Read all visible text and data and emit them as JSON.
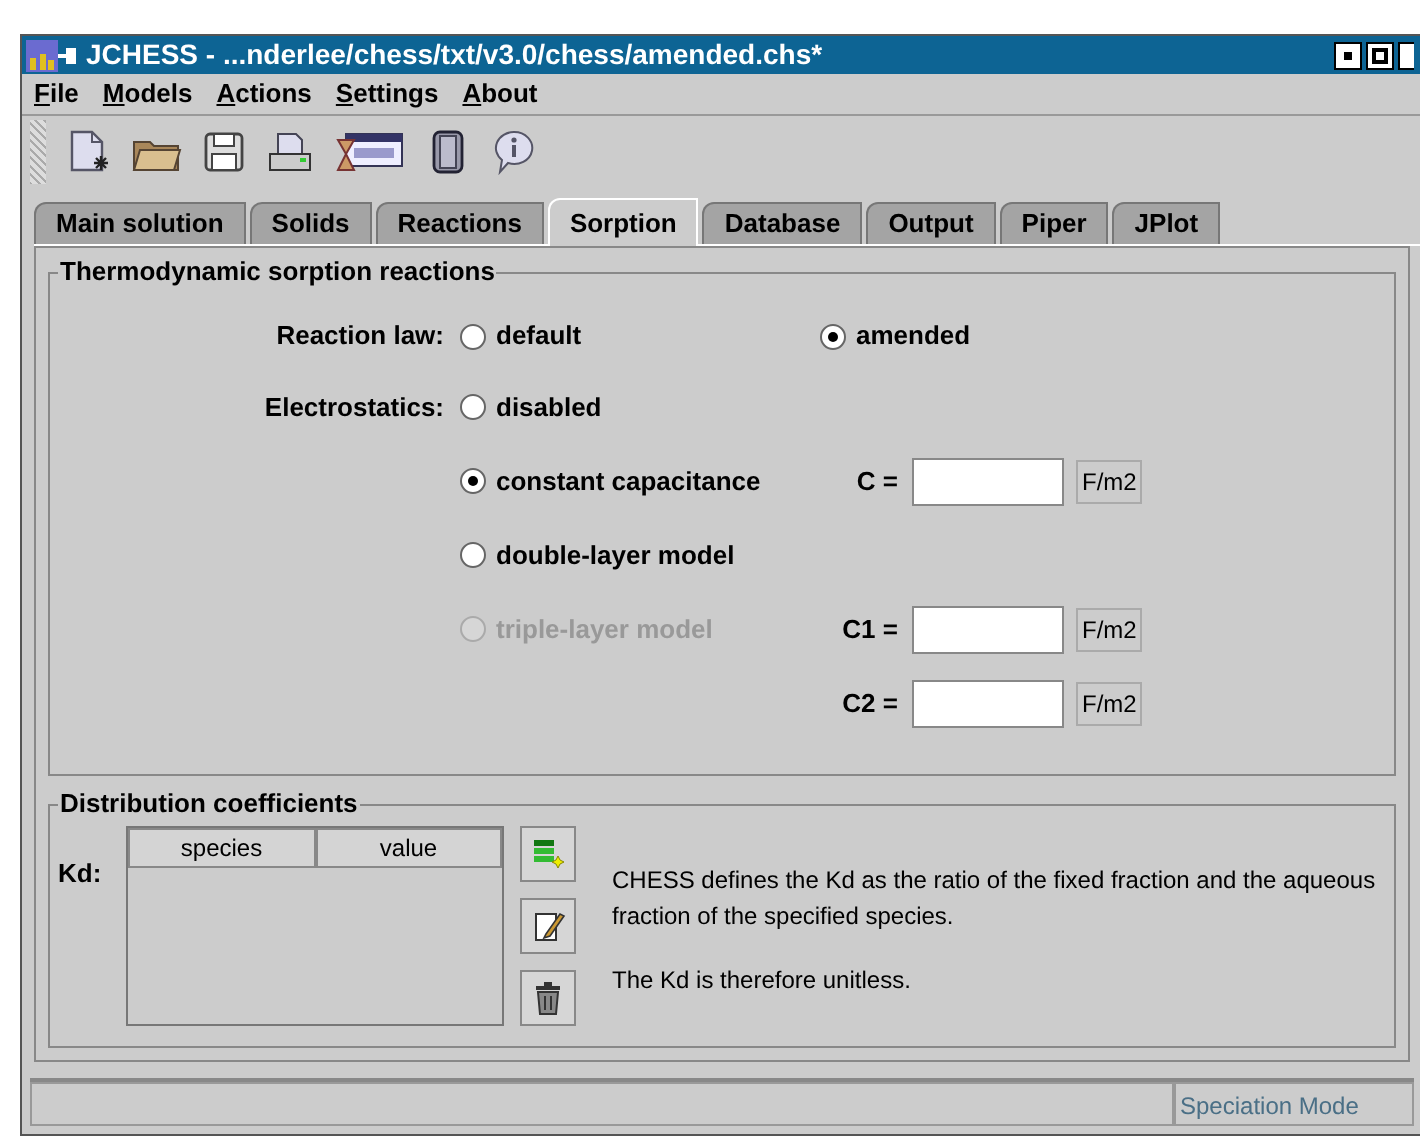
{
  "window": {
    "title": "JCHESS - ...nderlee/chess/txt/v3.0/chess/amended.chs*"
  },
  "menu": [
    {
      "label": "File"
    },
    {
      "label": "Models"
    },
    {
      "label": "Actions"
    },
    {
      "label": "Settings"
    },
    {
      "label": "About"
    }
  ],
  "tabs": [
    {
      "label": "Main solution",
      "selected": false
    },
    {
      "label": "Solids",
      "selected": false
    },
    {
      "label": "Reactions",
      "selected": false
    },
    {
      "label": "Sorption",
      "selected": true
    },
    {
      "label": "Database",
      "selected": false
    },
    {
      "label": "Output",
      "selected": false
    },
    {
      "label": "Piper",
      "selected": false
    },
    {
      "label": "JPlot",
      "selected": false
    }
  ],
  "sorption": {
    "title": "Thermodynamic sorption reactions",
    "reaction_law": {
      "label": "Reaction law:",
      "options": [
        {
          "label": "default",
          "selected": false
        },
        {
          "label": "amended",
          "selected": true
        }
      ]
    },
    "electrostatics": {
      "label": "Electrostatics:",
      "options": [
        {
          "label": "disabled",
          "selected": false,
          "disabled": false
        },
        {
          "label": "constant capacitance",
          "selected": true,
          "disabled": false,
          "fields": [
            {
              "label": "C =",
              "unit": "F/m2"
            }
          ]
        },
        {
          "label": "double-layer model",
          "selected": false,
          "disabled": false
        },
        {
          "label": "triple-layer model",
          "selected": false,
          "disabled": true,
          "fields": [
            {
              "label": "C1 =",
              "unit": "F/m2"
            },
            {
              "label": "C2 =",
              "unit": "F/m2"
            }
          ]
        }
      ]
    }
  },
  "distribution": {
    "title": "Distribution coefficients",
    "kd": {
      "label": "Kd:",
      "columns": [
        "species",
        "value"
      ]
    },
    "description": [
      "CHESS defines the Kd as the ratio of the fixed fraction and the aqueous fraction of the specified species.",
      "The Kd is therefore unitless."
    ]
  },
  "status_bar": {
    "mode": "Speciation Mode"
  }
}
